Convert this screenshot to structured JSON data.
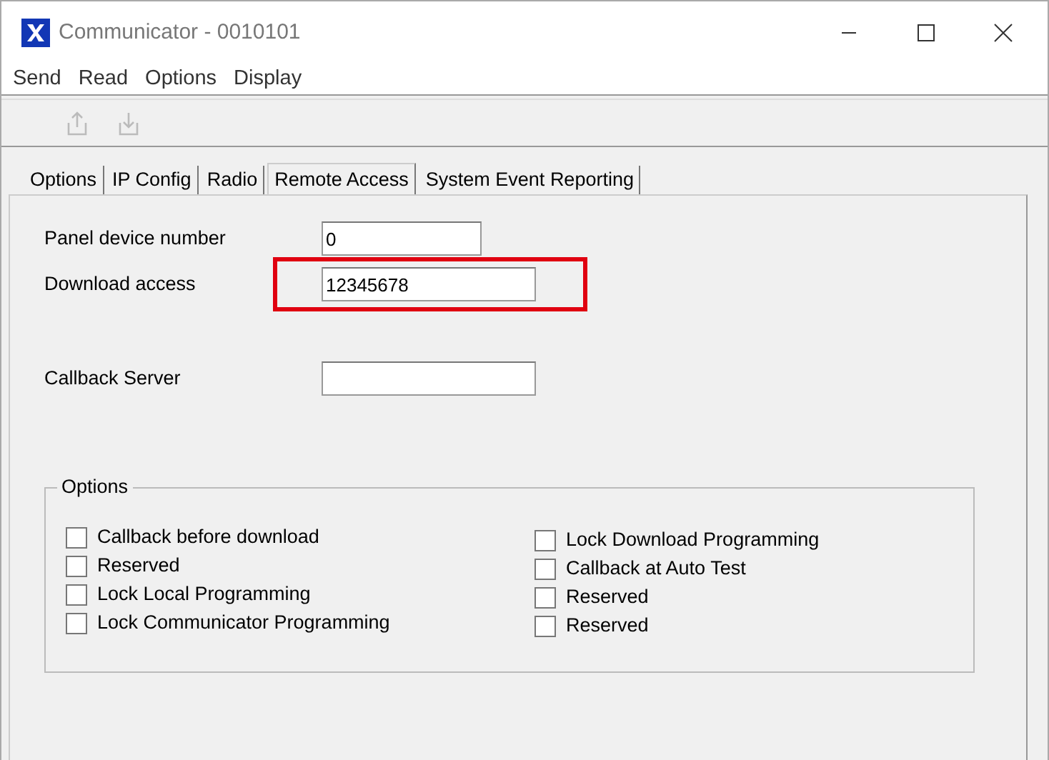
{
  "window": {
    "title": "Communicator - 0010101"
  },
  "menu": [
    "Send",
    "Read",
    "Options",
    "Display"
  ],
  "toolbar": [
    {
      "kind": "upload",
      "disabled": true
    },
    {
      "kind": "download",
      "disabled": true
    }
  ],
  "tabs": [
    {
      "label": "Options",
      "selected": false
    },
    {
      "label": "IP Config",
      "selected": false
    },
    {
      "label": "Radio",
      "selected": false
    },
    {
      "label": "Remote Access",
      "selected": true
    },
    {
      "label": "System Event Reporting",
      "selected": false
    }
  ],
  "fields": [
    {
      "label": "Panel device number",
      "value": "0",
      "highlighted": false,
      "gap_before": false
    },
    {
      "label": "Download access",
      "value": "12345678",
      "highlighted": true,
      "gap_before": false
    },
    {
      "label": "Callback Server",
      "highlighted": false,
      "gap_before": true
    }
  ],
  "options": {
    "title": "Options",
    "columns": [
      [
        {
          "label": "Callback before download",
          "checked": false
        },
        {
          "label": "Reserved",
          "checked": false
        },
        {
          "label": "Lock Local Programming",
          "checked": false
        },
        {
          "label": "Lock Communicator Programming",
          "checked": false
        }
      ],
      [
        {
          "label": "Lock Download Programming",
          "checked": false
        },
        {
          "label": "Callback at Auto Test",
          "checked": false
        },
        {
          "label": "Reserved",
          "checked": false
        },
        {
          "label": "Reserved",
          "checked": false
        }
      ]
    ]
  }
}
